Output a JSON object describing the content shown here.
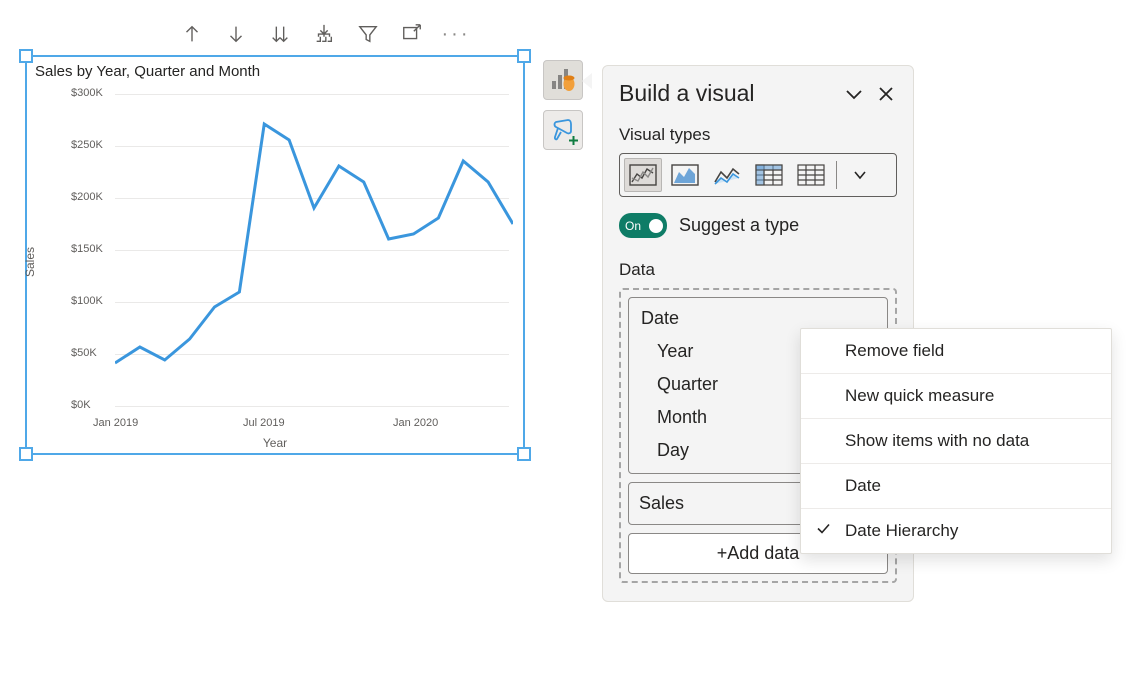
{
  "toolbar": {
    "icons": [
      "arrow-up",
      "arrow-down",
      "arrow-double-down",
      "hierarchy-expand",
      "filter",
      "popout",
      "more"
    ]
  },
  "chart_title": "Sales by Year, Quarter and Month",
  "chart_data": {
    "type": "line",
    "title": "Sales by Year, Quarter and Month",
    "xlabel": "Year",
    "ylabel": "Sales",
    "ylim": [
      0,
      300000
    ],
    "y_ticks": [
      "$0K",
      "$50K",
      "$100K",
      "$150K",
      "$200K",
      "$250K",
      "$300K"
    ],
    "x_ticks": [
      "Jan 2019",
      "Jul 2019",
      "Jan 2020"
    ],
    "categories": [
      "Jan 2019",
      "Feb 2019",
      "Mar 2019",
      "Apr 2019",
      "May 2019",
      "Jun 2019",
      "Jul 2019",
      "Aug 2019",
      "Sep 2019",
      "Oct 2019",
      "Nov 2019",
      "Dec 2019",
      "Jan 2020",
      "Feb 2020",
      "Mar 2020",
      "Apr 2020",
      "May 2020"
    ],
    "values": [
      37000,
      52000,
      40000,
      60000,
      90000,
      105000,
      265000,
      250000,
      185000,
      225000,
      210000,
      155000,
      160000,
      175000,
      230000,
      210000,
      170000
    ]
  },
  "pane": {
    "title": "Build a visual",
    "sections": {
      "visual_types": "Visual types",
      "data": "Data"
    },
    "toggle_on": "On",
    "toggle_label": "Suggest a type",
    "visual_types": [
      "line-chart",
      "area-chart",
      "stacked-area",
      "matrix",
      "table"
    ],
    "fields": {
      "date": {
        "label": "Date",
        "children": [
          "Year",
          "Quarter",
          "Month",
          "Day"
        ]
      },
      "sales": {
        "label": "Sales"
      }
    },
    "add_data": "+Add data"
  },
  "context_menu": {
    "items": [
      {
        "label": "Remove field",
        "checked": false
      },
      {
        "label": "New quick measure",
        "checked": false
      },
      {
        "label": "Show items with no data",
        "checked": false
      },
      {
        "label": "Date",
        "checked": false
      },
      {
        "label": "Date Hierarchy",
        "checked": true
      }
    ]
  }
}
